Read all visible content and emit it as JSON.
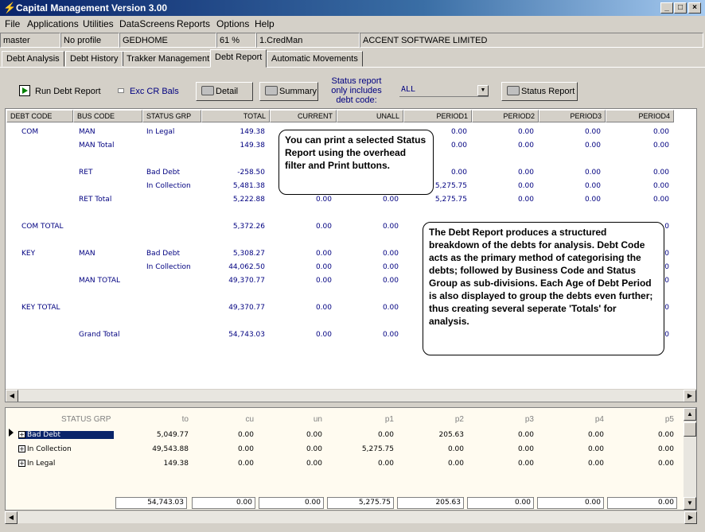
{
  "window": {
    "title": "Capital Management Version 3.00"
  },
  "menu": [
    "File",
    "Applications",
    "Utilities",
    "DataScreens",
    "Reports",
    "Options",
    "Help"
  ],
  "status_fields": [
    "master",
    "No profile",
    "GEDHOME",
    "61 %",
    "1.CredMan",
    "ACCENT SOFTWARE LIMITED"
  ],
  "tabs": [
    "Debt Analysis",
    "Debt History",
    "Trakker Management",
    "Debt Report",
    "Automatic Movements"
  ],
  "toolbar": {
    "run_label": "Run Debt Report",
    "exc_label": "Exc CR Bals",
    "detail_label": "Detail",
    "summary_label": "Summary",
    "status_line1": "Status report",
    "status_line2": "only includes",
    "status_line3": "debt code:",
    "filter_value": "ALL",
    "status_report_label": "Status Report"
  },
  "grid": {
    "headers": [
      "DEBT CODE",
      "BUS CODE",
      "STATUS GRP",
      "TOTAL",
      "CURRENT",
      "UNALL",
      "PERIOD1",
      "PERIOD2",
      "PERIOD3",
      "PERIOD4"
    ],
    "rows": [
      [
        "COM",
        "MAN",
        "In Legal",
        "149.38",
        "",
        "",
        "0.00",
        "0.00",
        "0.00",
        "0.00"
      ],
      [
        "",
        "MAN Total",
        "",
        "149.38",
        "",
        "",
        "0.00",
        "0.00",
        "0.00",
        "0.00"
      ],
      [
        "",
        "",
        "",
        "",
        "",
        "",
        "",
        "",
        "",
        ""
      ],
      [
        "",
        "RET",
        "Bad Debt",
        "-258.50",
        "",
        "",
        "0.00",
        "0.00",
        "0.00",
        "0.00"
      ],
      [
        "",
        "",
        "In Collection",
        "5,481.38",
        "",
        "",
        "5,275.75",
        "0.00",
        "0.00",
        "0.00"
      ],
      [
        "",
        "RET Total",
        "",
        "5,222.88",
        "0.00",
        "0.00",
        "5,275.75",
        "0.00",
        "0.00",
        "0.00"
      ],
      [
        "",
        "",
        "",
        "",
        "",
        "",
        "",
        "",
        "",
        ""
      ],
      [
        "COM TOTAL",
        "",
        "",
        "5,372.26",
        "0.00",
        "0.00",
        "",
        "",
        "",
        "0"
      ],
      [
        "",
        "",
        "",
        "",
        "",
        "",
        "",
        "",
        "",
        ""
      ],
      [
        "KEY",
        "MAN",
        "Bad Debt",
        "5,308.27",
        "0.00",
        "0.00",
        "",
        "",
        "",
        "0"
      ],
      [
        "",
        "",
        "In Collection",
        "44,062.50",
        "0.00",
        "0.00",
        "",
        "",
        "",
        "0"
      ],
      [
        "",
        "MAN TOTAL",
        "",
        "49,370.77",
        "0.00",
        "0.00",
        "",
        "",
        "",
        "0"
      ],
      [
        "",
        "",
        "",
        "",
        "",
        "",
        "",
        "",
        "",
        ""
      ],
      [
        "KEY TOTAL",
        "",
        "",
        "49,370.77",
        "0.00",
        "0.00",
        "",
        "",
        "",
        "0"
      ],
      [
        "",
        "",
        "",
        "",
        "",
        "",
        "",
        "",
        "",
        ""
      ],
      [
        "",
        "Grand Total",
        "",
        "54,743.03",
        "0.00",
        "0.00",
        "",
        "",
        "",
        "0"
      ]
    ]
  },
  "notes": {
    "note1": "You can print a selected Status Report using the overhead filter and Print buttons.",
    "note2": "The Debt Report produces a structured breakdown of the debts for analysis. Debt Code acts as the primary method of categorising the debts; followed by Business Code and Status Group as sub-divisions. Each Age of Debt Period is also displayed to group the debts even further; thus creating several seperate 'Totals' for analysis."
  },
  "lower": {
    "headers": [
      "STATUS GRP",
      "to",
      "cu",
      "un",
      "p1",
      "p2",
      "p3",
      "p4",
      "p5"
    ],
    "rows": [
      [
        "Bad Debt",
        "5,049.77",
        "0.00",
        "0.00",
        "0.00",
        "205.63",
        "0.00",
        "0.00",
        "0.00"
      ],
      [
        "In Collection",
        "49,543.88",
        "0.00",
        "0.00",
        "5,275.75",
        "0.00",
        "0.00",
        "0.00",
        "0.00"
      ],
      [
        "In Legal",
        "149.38",
        "0.00",
        "0.00",
        "0.00",
        "0.00",
        "0.00",
        "0.00",
        "0.00"
      ]
    ],
    "totals": [
      "54,743.03",
      "0.00",
      "0.00",
      "5,275.75",
      "205.63",
      "0.00",
      "0.00",
      "0.00"
    ]
  }
}
